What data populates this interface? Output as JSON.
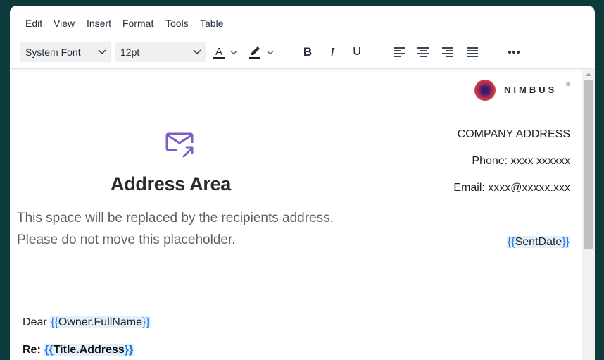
{
  "menubar": {
    "items": [
      {
        "label": "Edit"
      },
      {
        "label": "View"
      },
      {
        "label": "Insert"
      },
      {
        "label": "Format"
      },
      {
        "label": "Tools"
      },
      {
        "label": "Table"
      }
    ]
  },
  "toolbar": {
    "font_family": "System Font",
    "font_size": "12pt",
    "text_color_label": "A",
    "text_color": "#1f1f1f",
    "highlight_color": "#1f1f1f",
    "bold_label": "B",
    "italic_label": "I",
    "underline_label": "U"
  },
  "logo": {
    "text": "NIMBUS",
    "mark": "®"
  },
  "company": {
    "address": "COMPANY ADDRESS",
    "phone": "Phone: xxxx xxxxxx",
    "email": "Email: xxxx@xxxxx.xxx",
    "sent_date_open": "{{",
    "sent_date_field": "SentDate",
    "sent_date_close": "}}"
  },
  "address_placeholder": {
    "title": "Address Area",
    "description": "This space will be replaced by the recipients address. Please do not move this placeholder.",
    "icon": "mail-forward-icon",
    "icon_color": "#7b5fc6"
  },
  "letter": {
    "dear_prefix": "Dear",
    "owner_open": "{{",
    "owner_field": "Owner.FullName",
    "owner_close": "}}",
    "re_prefix": "Re:",
    "title_open": "{{",
    "title_field": "Title.Address",
    "title_close": "}}"
  },
  "colors": {
    "background": "#0e3a3b",
    "tag_background": "#e3f0fc",
    "brace": "#1a73e8"
  }
}
